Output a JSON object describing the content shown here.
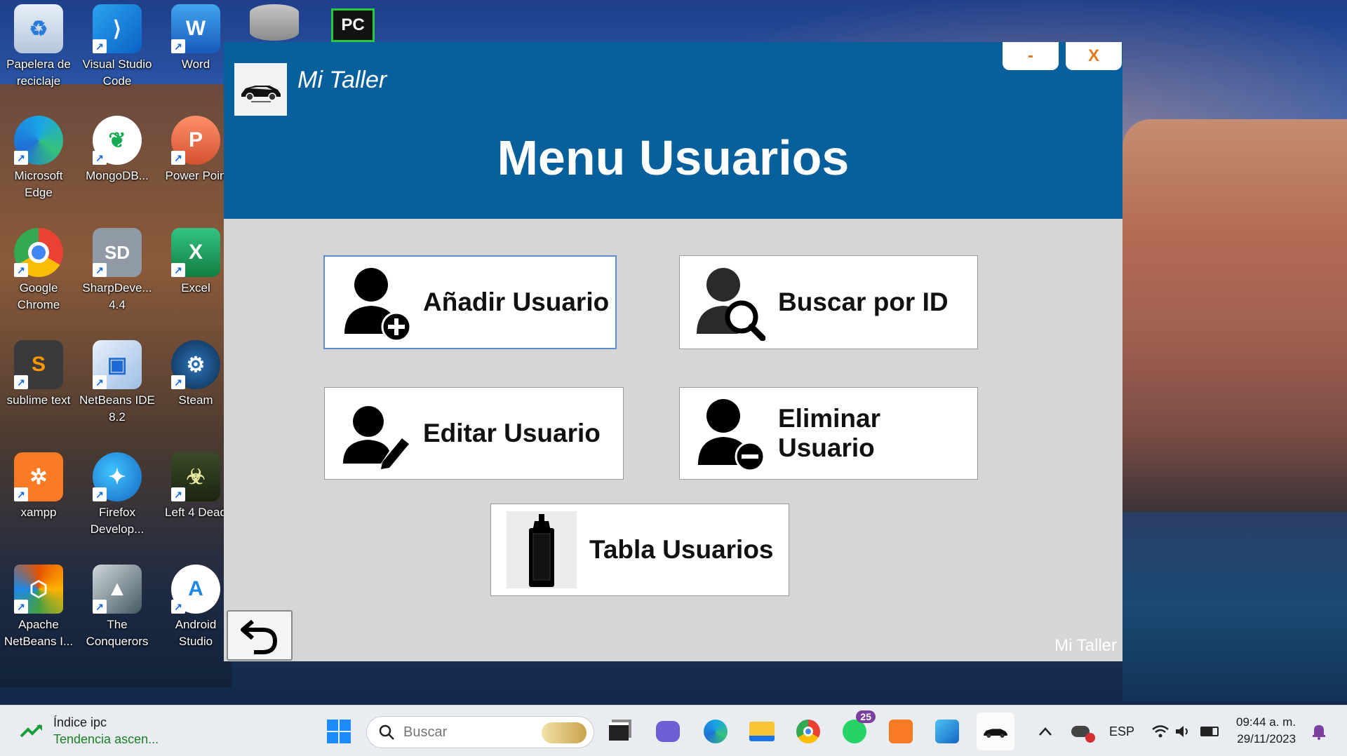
{
  "desktop": {
    "icons": [
      {
        "label": "Papelera de reciclaje",
        "icon": "recycle-bin-icon"
      },
      {
        "label": "Visual Studio Code",
        "icon": "vscode-icon"
      },
      {
        "label": "Word",
        "icon": "word-icon"
      },
      {
        "label": "Microsoft Edge",
        "icon": "edge-icon"
      },
      {
        "label": "MongoDB...",
        "icon": "mongodb-icon"
      },
      {
        "label": "Power Poin",
        "icon": "powerpoint-icon"
      },
      {
        "label": "Google Chrome",
        "icon": "chrome-icon"
      },
      {
        "label": "SharpDeve... 4.4",
        "icon": "sharpdevelop-icon"
      },
      {
        "label": "Excel",
        "icon": "excel-icon"
      },
      {
        "label": "sublime text",
        "icon": "sublime-icon"
      },
      {
        "label": "NetBeans IDE 8.2",
        "icon": "netbeans-icon"
      },
      {
        "label": "Steam",
        "icon": "steam-icon"
      },
      {
        "label": "xampp",
        "icon": "xampp-icon"
      },
      {
        "label": "Firefox Develop...",
        "icon": "firefox-icon"
      },
      {
        "label": "Left 4 Dead",
        "icon": "left4dead-icon"
      },
      {
        "label": "Apache NetBeans I...",
        "icon": "apache-netbeans-icon"
      },
      {
        "label": "The Conquerors",
        "icon": "conquerors-icon"
      },
      {
        "label": "Android Studio",
        "icon": "android-studio-icon"
      }
    ],
    "glyphs": {
      "word": "W",
      "powerpoint": "P",
      "excel": "X",
      "sharpdevelop": "SD",
      "pycharm": "PC"
    }
  },
  "app": {
    "name": "Mi Taller",
    "minimize_label": "-",
    "close_label": "X",
    "title": "Menu Usuarios",
    "buttons": {
      "add": "Añadir Usuario",
      "search": "Buscar por ID",
      "edit": "Editar Usuario",
      "delete": "Eliminar Usuario",
      "table": "Tabla Usuarios"
    },
    "footer": "Mi Taller",
    "colors": {
      "header": "#07609c",
      "body": "#d6d6d6",
      "window_buttons_text": "#e07a1f"
    }
  },
  "taskbar": {
    "news_title": "Índice ipc",
    "news_subtitle": "Tendencia ascen...",
    "search_placeholder": "Buscar",
    "whatsapp_badge": "25",
    "language": "ESP",
    "time": "09:44 a. m.",
    "date": "29/11/2023"
  }
}
